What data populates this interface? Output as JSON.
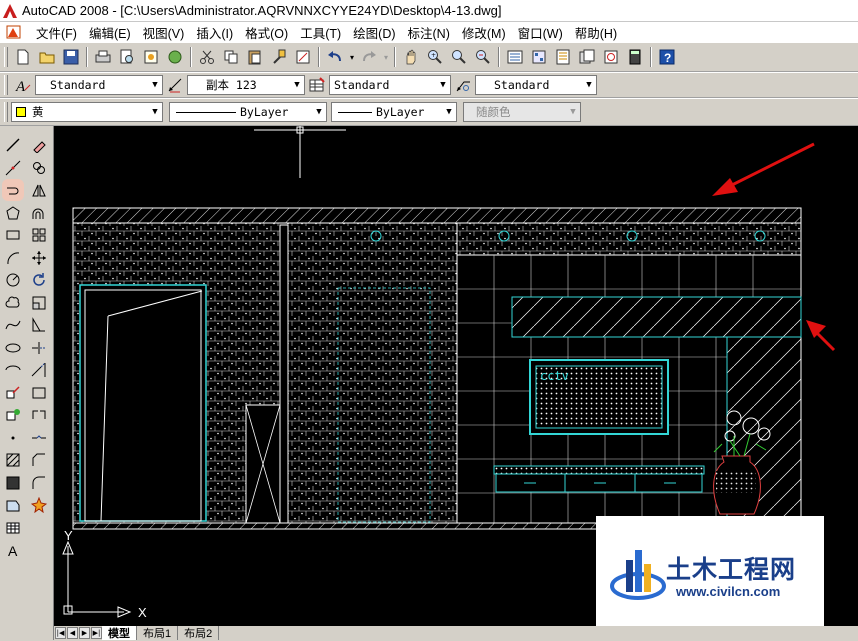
{
  "window": {
    "title": "AutoCAD 2008 - [C:\\Users\\Administrator.AQRVNNXCYYE24YD\\Desktop\\4-13.dwg]"
  },
  "menu": [
    "文件(F)",
    "编辑(E)",
    "视图(V)",
    "插入(I)",
    "格式(O)",
    "工具(T)",
    "绘图(D)",
    "标注(N)",
    "修改(M)",
    "窗口(W)",
    "帮助(H)"
  ],
  "styles_toolbar": {
    "text_style": "Standard",
    "dim_style": "副本 123",
    "table_style": "Standard",
    "multileader_style": "Standard"
  },
  "layers_toolbar": {
    "color": "黄",
    "linetype": "ByLayer",
    "lineweight": "ByLayer",
    "plot_style": "随颜色"
  },
  "drawing": {
    "tv_label": "cctv",
    "ucs_x": "X",
    "ucs_y": "Y"
  },
  "tabs": [
    "模型",
    "布局1",
    "布局2"
  ],
  "watermark": {
    "title": "土木工程网",
    "url": "www.civilcn.com"
  },
  "colors": {
    "canvas_bg": "#000000",
    "cad_line": "#ffffff",
    "cad_cyan": "#33d6d6",
    "arrow_red": "#e01010",
    "accent_blue": "#1a3f8a"
  }
}
